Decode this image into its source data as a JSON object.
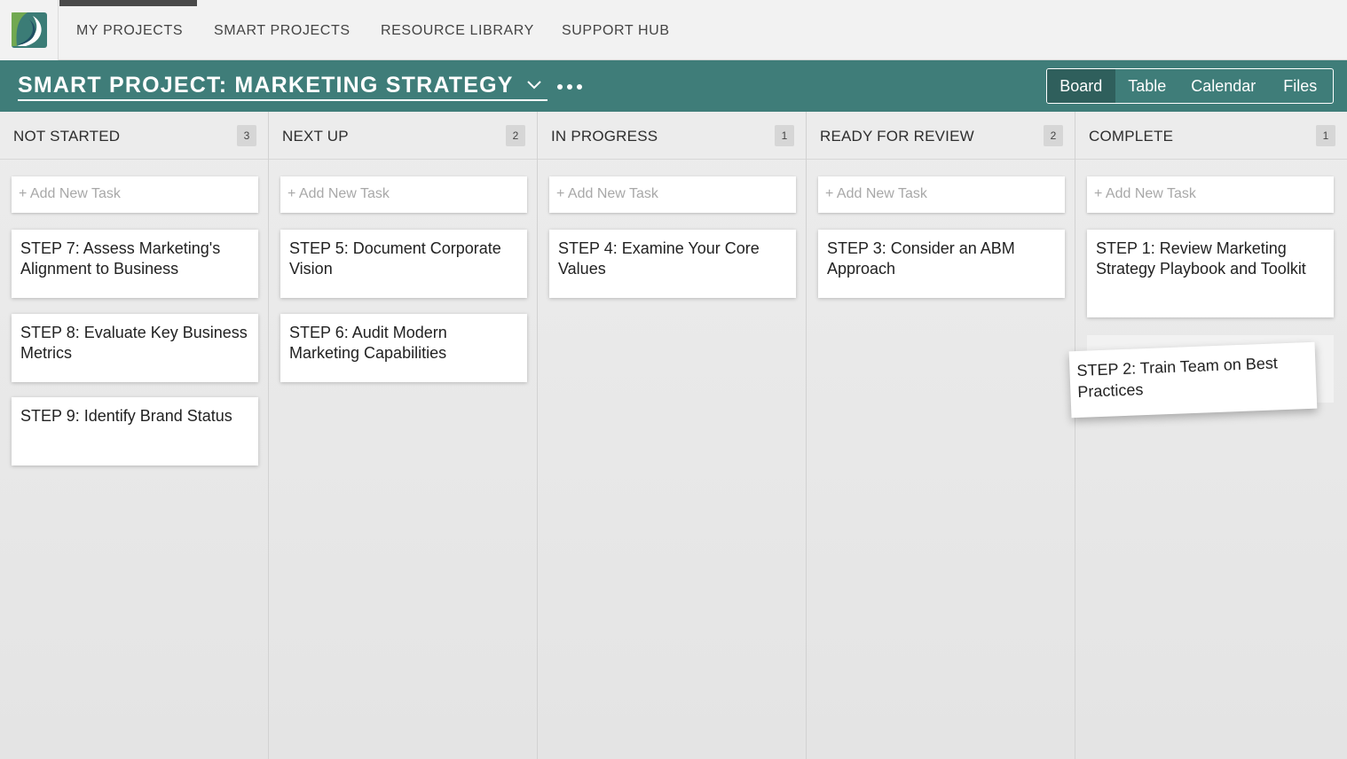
{
  "colors": {
    "accent": "#3f7d79",
    "accent_dark": "#2f5f5c",
    "nav_bg": "#f2f2f2",
    "board_bg": "#e9e9e9"
  },
  "nav": {
    "items": [
      "MY PROJECTS",
      "SMART PROJECTS",
      "RESOURCE LIBRARY",
      "SUPPORT HUB"
    ],
    "active": "MY PROJECTS"
  },
  "project": {
    "title": "SMART PROJECT: MARKETING STRATEGY",
    "views": [
      "Board",
      "Table",
      "Calendar",
      "Files"
    ],
    "active_view": "Board"
  },
  "board": {
    "add_task_label": "+ Add New Task",
    "columns": [
      {
        "title": "NOT STARTED",
        "count": "3",
        "cards": [
          "STEP 7: Assess Marketing's Alignment to Business",
          "STEP 8: Evaluate Key Business Metrics",
          "STEP 9: Identify Brand Status"
        ]
      },
      {
        "title": "NEXT UP",
        "count": "2",
        "cards": [
          "STEP 5: Document Corporate Vision",
          "STEP 6: Audit Modern Marketing Capabilities"
        ]
      },
      {
        "title": "IN PROGRESS",
        "count": "1",
        "cards": [
          "STEP 4: Examine Your Core Values"
        ]
      },
      {
        "title": "READY FOR REVIEW",
        "count": "2",
        "cards": [
          "STEP 3: Consider an ABM Approach"
        ]
      },
      {
        "title": "COMPLETE",
        "count": "1",
        "cards": [
          "STEP 1: Review Marketing Strategy Playbook and Toolkit"
        ]
      }
    ],
    "dragging_card": "STEP 2: Train Team on Best Practices"
  }
}
